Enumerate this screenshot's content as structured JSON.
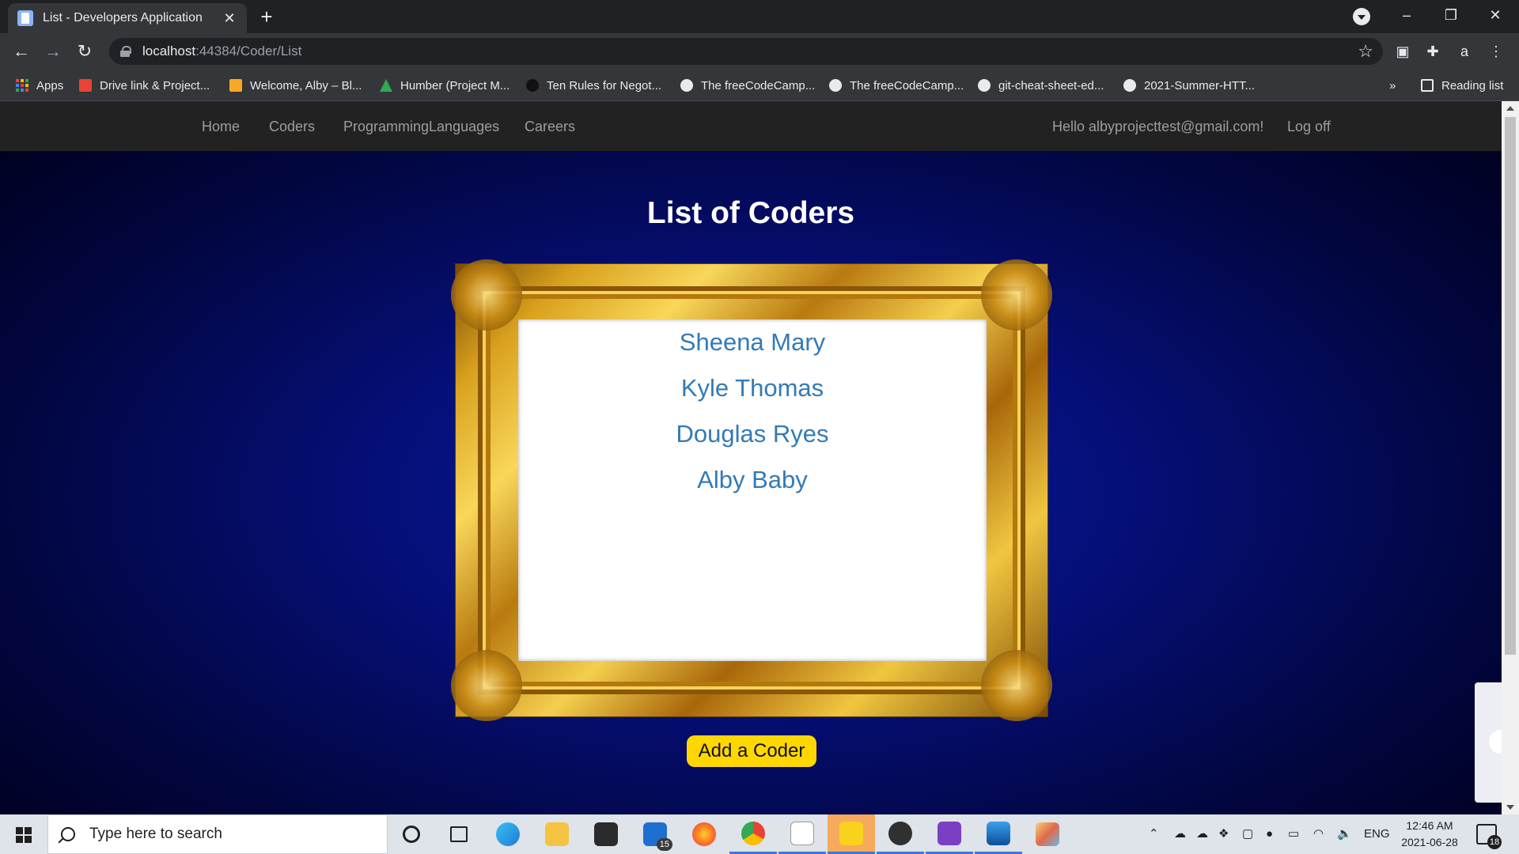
{
  "browser": {
    "tab_title": "List - Developers Application",
    "new_tab": "+",
    "tab_close": "✕",
    "url_host": "localhost",
    "url_path": ":44384/Coder/List",
    "profile_letter": "a",
    "bookmarks": [
      {
        "label": "Apps",
        "icon": "apps-grid-icon"
      },
      {
        "label": "Drive link & Project...",
        "icon": "gmail-icon"
      },
      {
        "label": "Welcome, Alby – Bl...",
        "icon": "pencil-icon"
      },
      {
        "label": "Humber (Project M...",
        "icon": "google-drive-icon"
      },
      {
        "label": "Ten Rules for Negot...",
        "icon": "a-icon"
      },
      {
        "label": "The freeCodeCamp...",
        "icon": "freecodecamp-icon"
      },
      {
        "label": "The freeCodeCamp...",
        "icon": "freecodecamp-icon"
      },
      {
        "label": "git-cheat-sheet-ed...",
        "icon": "github-icon"
      },
      {
        "label": "2021-Summer-HTT...",
        "icon": "github-icon"
      }
    ],
    "bookmarks_overflow": "»",
    "reading_list": "Reading list"
  },
  "site_nav": {
    "links": [
      "Home",
      "Coders",
      "ProgrammingLanguages",
      "Careers"
    ],
    "greeting": "Hello albyprojecttest@gmail.com!",
    "logoff": "Log off"
  },
  "main": {
    "title": "List of Coders",
    "coders": [
      "Sheena Mary",
      "Kyle Thomas",
      "Douglas Ryes",
      "Alby Baby"
    ],
    "add_button": "Add a Coder"
  },
  "taskbar": {
    "search_placeholder": "Type here to search",
    "mail_badge": "15",
    "language": "ENG",
    "time": "12:46 AM",
    "date": "2021-06-28",
    "notification_count": "18"
  },
  "colors": {
    "link": "#337ab7",
    "button": "#ffd700",
    "navbar": "#222222"
  }
}
